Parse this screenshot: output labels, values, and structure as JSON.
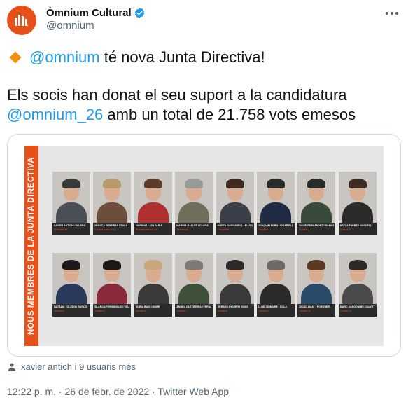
{
  "account": {
    "display_name": "Òmnium Cultural",
    "handle": "@omnium"
  },
  "tweet": {
    "line1_mention": "@omnium",
    "line1_text": " té nova Junta Directiva!",
    "line2_text": "Els socis han donat el seu suport a la candidatura",
    "line3_mention": "@omnium_26",
    "line3_text": " amb un total de 21.758 vots emesos"
  },
  "media": {
    "banner_text": "NOUS MEMBRES DE LA JUNTA DIRECTIVA",
    "members_row1": [
      {
        "name": "XAVIER ANTICH I VALERO",
        "role": "Presidència"
      },
      {
        "name": "MONICA TERRIBAS I SALA",
        "role": "Vicepresidència 1a"
      },
      {
        "name": "MARINA LLAY I FARIA",
        "role": "Vicepresidència 2a"
      },
      {
        "name": "MARINA GALLÉS I CLARÀ",
        "role": "Secretaria"
      },
      {
        "name": "MARTA GARGANELL I PUJOL",
        "role": "Tresoreria"
      },
      {
        "name": "JOAQUIM FORN I CHIARIELLO",
        "role": "Vocalia 1"
      },
      {
        "name": "DAVID FERNÁNDEZ I RAMOS",
        "role": "Vocalia 2"
      },
      {
        "name": "NATZA FARRÉ I MADUELL",
        "role": "Vocalia 3"
      }
    ],
    "members_row2": [
      {
        "name": "NATÀLIA TOLEDO I BARCÓ",
        "role": "Vocalia 4"
      },
      {
        "name": "BLANCA FORSMOLLO I VALLÉS",
        "role": "Vocalia 5"
      },
      {
        "name": "NÚRIA BASI I MORÉ",
        "role": "Vocalia 6"
      },
      {
        "name": "ÀNGEL CASTIÑEIRA I FERNÁNDEZ",
        "role": "Vocalia 7"
      },
      {
        "name": "GERARD PIQUER I ROMS",
        "role": "Vocalia 8"
      },
      {
        "name": "LLUÍS DONAIRE I SOLÀ",
        "role": "Vocalia 9"
      },
      {
        "name": "DIDAC AMAT I PORQUER",
        "role": "Vocalia 10"
      },
      {
        "name": "MARC SANGONNE I CALVET",
        "role": "Vocalia 11"
      }
    ]
  },
  "likes_text": "xavier antich i 9 usuaris més",
  "footer_text": "12:22 p. m. · 26 de febr. de 2022 · Twitter Web App",
  "colors": {
    "accent": "#1d9bf0",
    "brand": "#e8501a",
    "diamond": "#f4900c"
  }
}
